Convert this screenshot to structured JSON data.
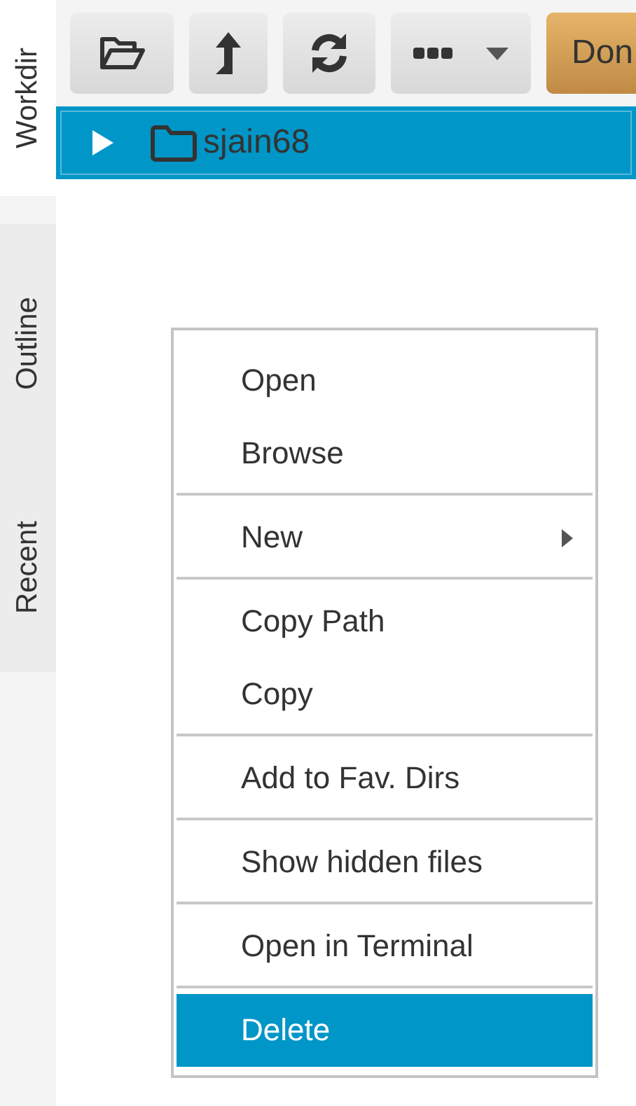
{
  "sidebar": {
    "tabs": [
      {
        "label": "Workdir",
        "selected": true
      },
      {
        "label": "Outline",
        "selected": false
      },
      {
        "label": "Recent",
        "selected": false
      }
    ]
  },
  "toolbar": {
    "buttons": [
      {
        "kind": "open-folder"
      },
      {
        "kind": "up"
      },
      {
        "kind": "refresh"
      },
      {
        "kind": "more"
      },
      {
        "kind": "text",
        "label": "Don"
      }
    ]
  },
  "tree": [
    {
      "name": "sjain68",
      "expanded": false,
      "selected": true
    }
  ],
  "context_menu": {
    "sections": [
      {
        "items": [
          {
            "label": "Open",
            "submenu": false,
            "selected": false
          },
          {
            "label": "Browse",
            "submenu": false,
            "selected": false
          }
        ]
      },
      {
        "items": [
          {
            "label": "New",
            "submenu": true,
            "selected": false
          }
        ]
      },
      {
        "items": [
          {
            "label": "Copy Path",
            "submenu": false,
            "selected": false
          },
          {
            "label": "Copy",
            "submenu": false,
            "selected": false
          }
        ]
      },
      {
        "items": [
          {
            "label": "Add to Fav. Dirs",
            "submenu": false,
            "selected": false
          }
        ]
      },
      {
        "items": [
          {
            "label": "Show hidden files",
            "submenu": false,
            "selected": false
          }
        ]
      },
      {
        "items": [
          {
            "label": "Open in Terminal",
            "submenu": false,
            "selected": false
          }
        ]
      },
      {
        "items": [
          {
            "label": "Delete",
            "submenu": false,
            "selected": true
          }
        ]
      }
    ]
  }
}
